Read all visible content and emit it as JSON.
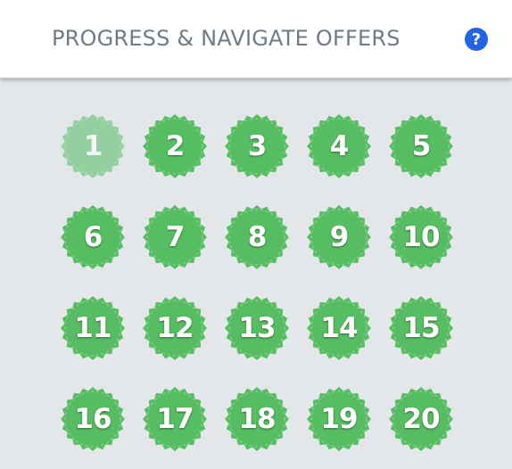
{
  "header": {
    "title": "PROGRESS & NAVIGATE OFFERS",
    "help_icon": "question-circle-icon"
  },
  "colors": {
    "badge_green": "#57bd62",
    "badge_rim": "#7fcf87",
    "help_blue": "#2463e6",
    "title_gray": "#6f7b86",
    "background": "#e3e7ea"
  },
  "offers": [
    {
      "label": "1",
      "completed": true
    },
    {
      "label": "2",
      "completed": false
    },
    {
      "label": "3",
      "completed": false
    },
    {
      "label": "4",
      "completed": false
    },
    {
      "label": "5",
      "completed": false
    },
    {
      "label": "6",
      "completed": false
    },
    {
      "label": "7",
      "completed": false
    },
    {
      "label": "8",
      "completed": false
    },
    {
      "label": "9",
      "completed": false
    },
    {
      "label": "10",
      "completed": false
    },
    {
      "label": "11",
      "completed": false
    },
    {
      "label": "12",
      "completed": false
    },
    {
      "label": "13",
      "completed": false
    },
    {
      "label": "14",
      "completed": false
    },
    {
      "label": "15",
      "completed": false
    },
    {
      "label": "16",
      "completed": false
    },
    {
      "label": "17",
      "completed": false
    },
    {
      "label": "18",
      "completed": false
    },
    {
      "label": "19",
      "completed": false
    },
    {
      "label": "20",
      "completed": false
    }
  ]
}
